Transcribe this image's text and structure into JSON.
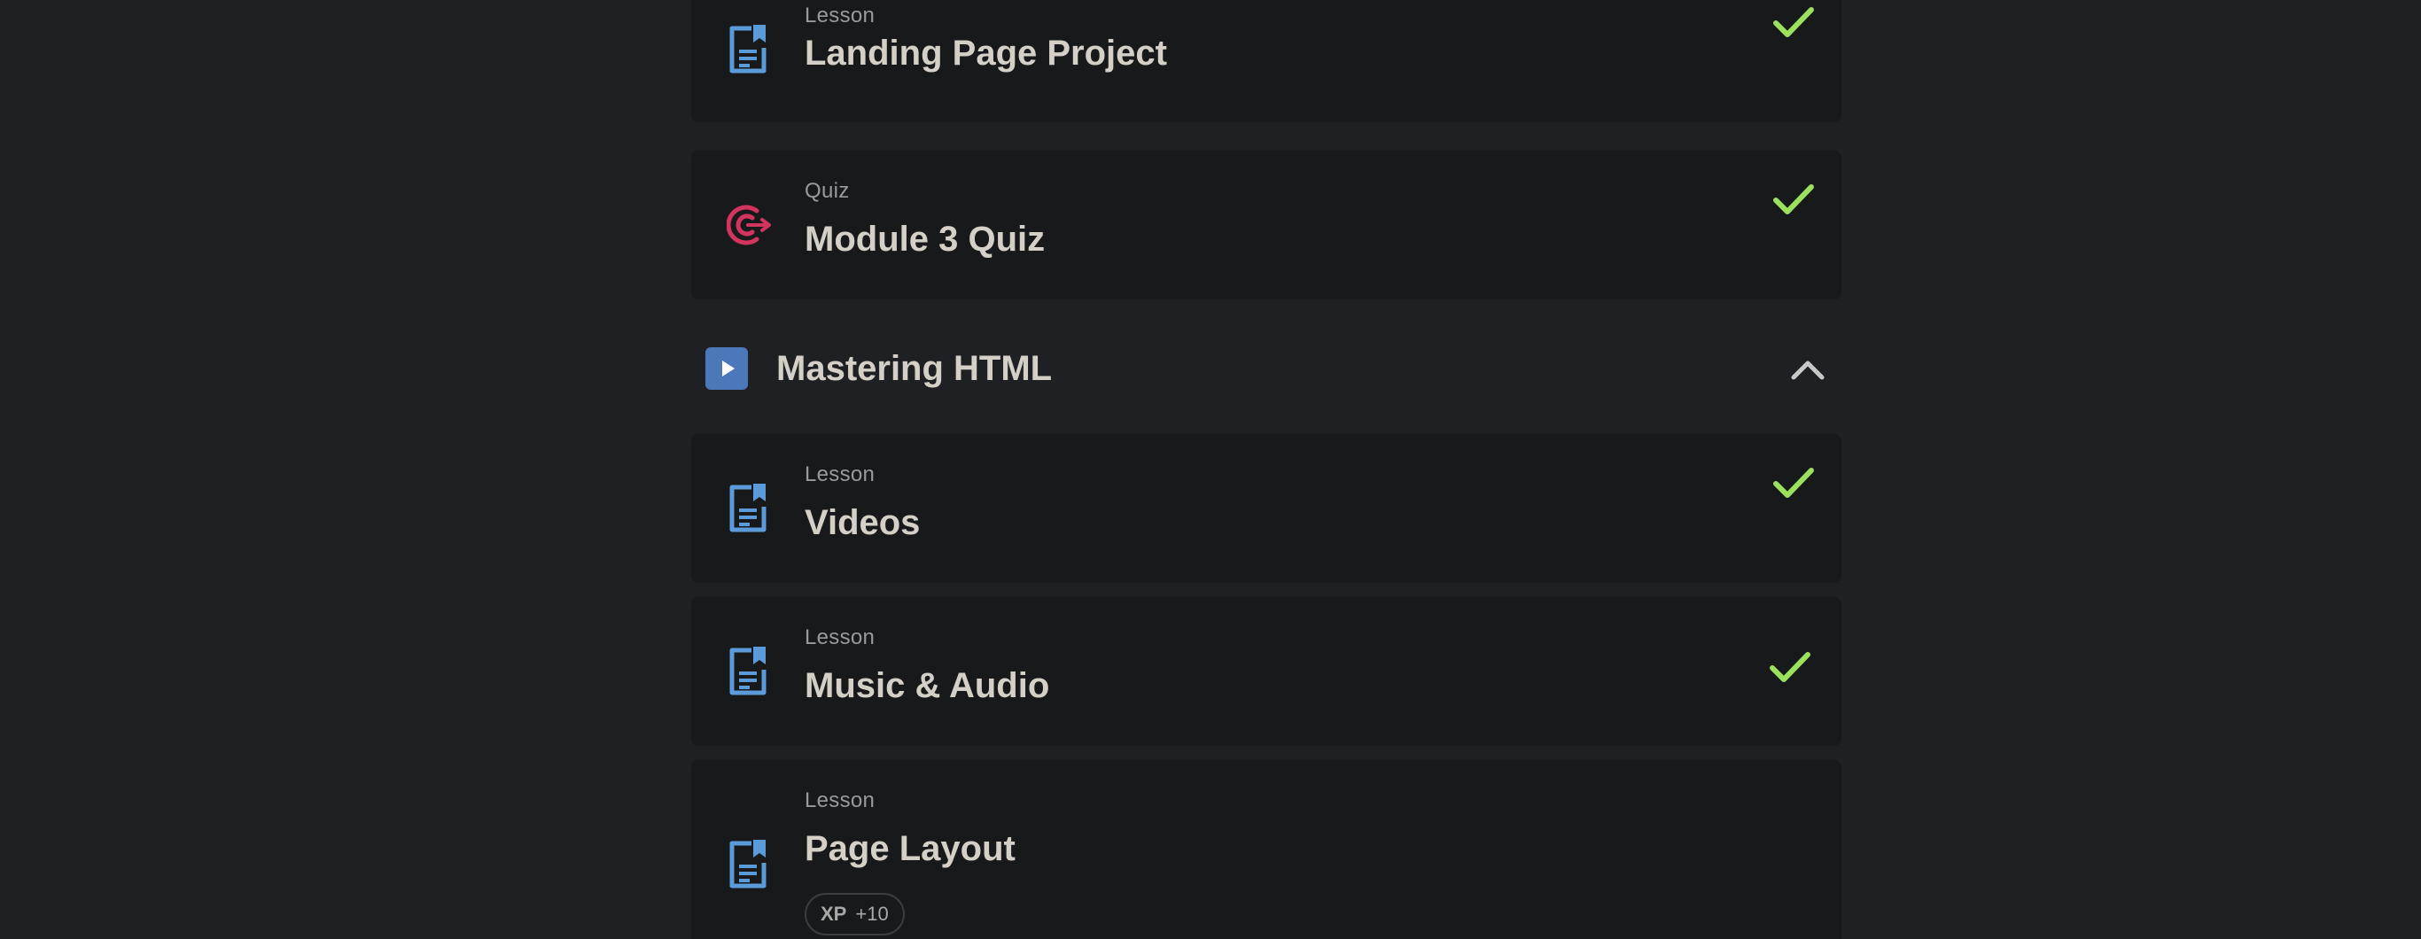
{
  "items_before": [
    {
      "type": "Lesson",
      "title": "Landing Page Project",
      "icon": "document-bookmark-icon",
      "completed": true
    },
    {
      "type": "Quiz",
      "title": "Module 3 Quiz",
      "icon": "target-icon",
      "completed": true
    }
  ],
  "section": {
    "title": "Mastering HTML",
    "icon": "play-icon",
    "toggle_icon": "chevron-up-icon"
  },
  "items_after": [
    {
      "type": "Lesson",
      "title": "Videos",
      "icon": "document-bookmark-icon",
      "completed": true
    },
    {
      "type": "Lesson",
      "title": "Music & Audio",
      "icon": "document-bookmark-icon",
      "completed": true
    },
    {
      "type": "Lesson",
      "title": "Page Layout",
      "icon": "document-bookmark-icon",
      "completed": false,
      "xp": {
        "label": "XP",
        "value": "+10"
      }
    }
  ],
  "colors": {
    "background": "#1f2023",
    "card": "#18191b",
    "lesson_icon": "#5b9bd9",
    "quiz_icon": "#d2345f",
    "check": "#9be15d",
    "play_box": "#4a78b8",
    "title_text": "#d4d0c8"
  }
}
